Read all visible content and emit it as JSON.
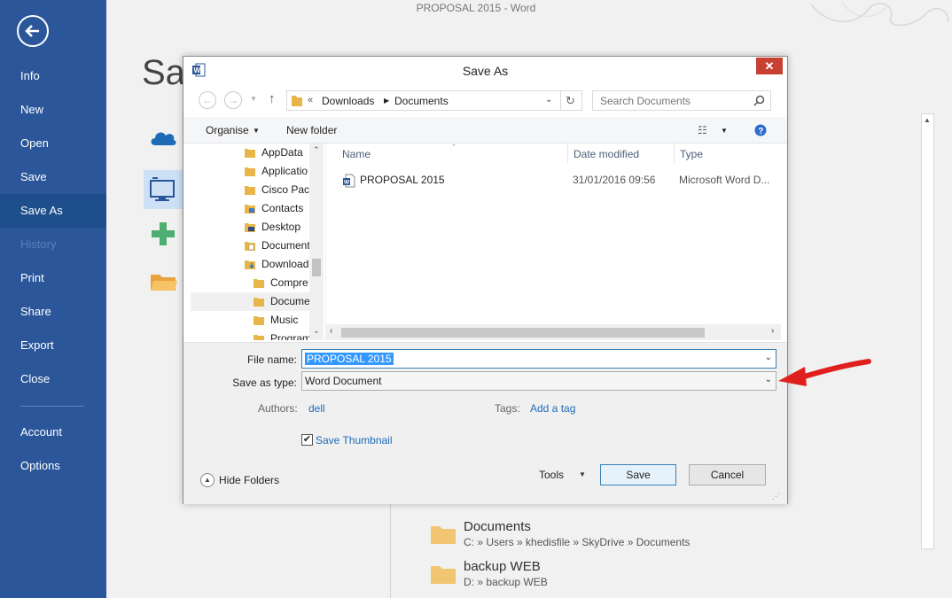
{
  "window": {
    "title": "PROPOSAL 2015 - Word"
  },
  "sidebar": {
    "items": [
      {
        "label": "Info"
      },
      {
        "label": "New"
      },
      {
        "label": "Open"
      },
      {
        "label": "Save"
      },
      {
        "label": "Save As",
        "active": true
      },
      {
        "label": "History",
        "disabled": true
      },
      {
        "label": "Print"
      },
      {
        "label": "Share"
      },
      {
        "label": "Export"
      },
      {
        "label": "Close"
      },
      {
        "label": "Account"
      },
      {
        "label": "Options"
      }
    ]
  },
  "backstage": {
    "heading": "Sav",
    "recent_folders": [
      {
        "name": "Documents",
        "path": "C: » Users » khedisfile » SkyDrive » Documents"
      },
      {
        "name": "backup WEB",
        "path": "D: » backup WEB"
      }
    ]
  },
  "dialog": {
    "title": "Save As",
    "close_label": "✕",
    "address": {
      "overflow": "«",
      "crumbs": [
        "Downloads",
        "Documents"
      ]
    },
    "search": {
      "placeholder": "Search Documents"
    },
    "commands": {
      "organise": "Organise",
      "new_folder": "New folder"
    },
    "tree": [
      {
        "label": "AppData"
      },
      {
        "label": "Applicatio"
      },
      {
        "label": "Cisco Pacl"
      },
      {
        "label": "Contacts"
      },
      {
        "label": "Desktop"
      },
      {
        "label": "Document"
      },
      {
        "label": "Download"
      },
      {
        "label": "Compre"
      },
      {
        "label": "Docume",
        "selected": true
      },
      {
        "label": "Music"
      },
      {
        "label": "Program"
      }
    ],
    "columns": {
      "name": "Name",
      "date": "Date modified",
      "type": "Type"
    },
    "files": [
      {
        "name": "PROPOSAL 2015",
        "date": "31/01/2016 09:56",
        "type": "Microsoft Word D..."
      }
    ],
    "form": {
      "file_name_label": "File name:",
      "file_name_value": "PROPOSAL 2015",
      "save_type_label": "Save as type:",
      "save_type_value": "Word Document",
      "authors_label": "Authors:",
      "authors_value": "dell",
      "tags_label": "Tags:",
      "tags_value": "Add a tag",
      "thumbnail_label": "Save Thumbnail",
      "thumbnail_checked": true
    },
    "footer": {
      "hide_folders": "Hide Folders",
      "tools": "Tools",
      "save": "Save",
      "cancel": "Cancel"
    }
  },
  "colors": {
    "sidebar": "#2b579a",
    "accent": "#3399ff",
    "arrow": "#e0201e"
  }
}
